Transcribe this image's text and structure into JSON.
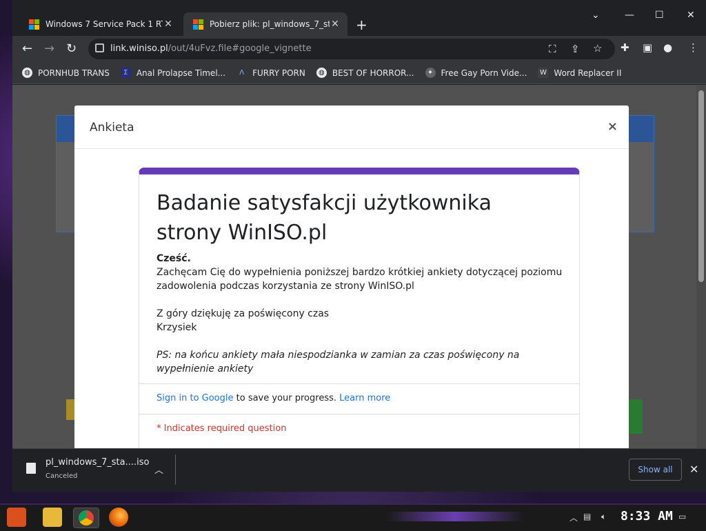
{
  "tabs": [
    {
      "title": "Windows 7 Service Pack 1 RTM",
      "active": false
    },
    {
      "title": "Pobierz plik: pl_windows_7_sta",
      "active": true
    }
  ],
  "address": {
    "host": "link.winiso.pl",
    "path": "/out/4uFvz.file#google_vignette"
  },
  "bookmarks": [
    {
      "label": "PORNHUB TRANS"
    },
    {
      "label": "Anal Prolapse Timel..."
    },
    {
      "label": "FURRY PORN"
    },
    {
      "label": "BEST OF HORROR..."
    },
    {
      "label": "Free Gay Porn Vide..."
    },
    {
      "label": "Word Replacer II"
    }
  ],
  "modal": {
    "title": "Ankieta",
    "close": "×"
  },
  "form": {
    "title": "Badanie satysfakcji użytkownika strony WinISO.pl",
    "greeting": "Cześć.",
    "intro": "Zachęcam Cię do wypełnienia poniższej bardzo krótkiej ankiety dotyczącej poziomu zadowolenia podczas korzystania ze strony WinISO.pl",
    "thanks": "Z góry dziękuję za poświęcony czas",
    "signature": "Krzysiek",
    "ps": "PS: na końcu ankiety mała niespodzianka w zamian za czas poświęcony na wypełnienie ankiety",
    "signin_link": "Sign in to Google",
    "signin_text": " to save your progress. ",
    "learn_more": "Learn more",
    "required": "* Indicates required question"
  },
  "download": {
    "filename": "pl_windows_7_sta....iso",
    "status": "Canceled",
    "show_all": "Show all"
  },
  "taskbar": {
    "clock": "8:33 AM"
  },
  "colors": {
    "form_accent": "#673ab7",
    "link": "#1a73e8",
    "required": "#d93025",
    "show_all": "#8ab4f8"
  }
}
